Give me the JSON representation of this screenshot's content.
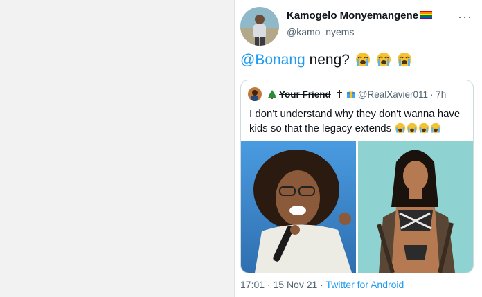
{
  "tweet": {
    "author_name": "Kamogelo Monyemangene",
    "author_handle": "@kamo_nyems",
    "more_label": "···",
    "mention": "@Bonang",
    "text_after_mention": " neng?",
    "timestamp": "17:01 · 15 Nov 21",
    "separator": " · ",
    "source": "Twitter for Android"
  },
  "quoted_tweet": {
    "name": "Your Friend",
    "handle": "@RealXavier011",
    "time": "· 7h",
    "text": "I don't understand why they don't wanna have kids so that the legacy extends"
  },
  "icons": {
    "author_avatar": "avatar-photo",
    "flag": "rainbow-flag-icon",
    "crying_emoji": "loudly-crying-face-icon",
    "tree": "christmas-tree-icon",
    "cross": "latin-cross-icon",
    "gift": "gift-icon"
  },
  "colors": {
    "link": "#1d9bf0",
    "secondary_text": "#536471",
    "border": "#cfd9de",
    "left_media_bg": "#3f8fd6",
    "right_media_bg": "#8ed3d2"
  }
}
